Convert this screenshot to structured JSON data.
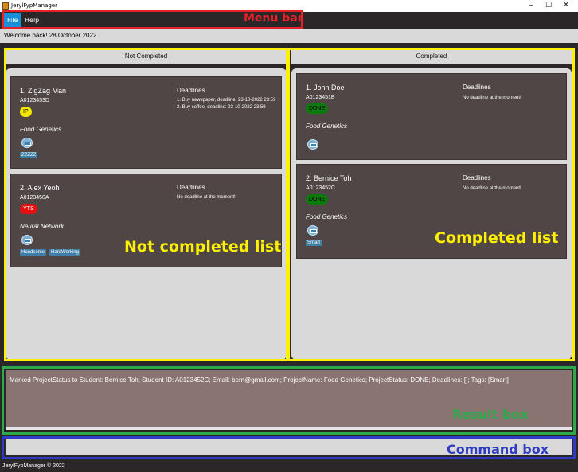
{
  "window": {
    "title": "JerylFypManager"
  },
  "menu": {
    "items": [
      "File",
      "Help"
    ]
  },
  "welcome": "Welcome back! 28 October 2022",
  "panels": {
    "not_completed": {
      "header": "Not Completed",
      "cards": [
        {
          "name": "1.  ZigZag Man",
          "id": "A0123453D",
          "status": "IP",
          "status_color": "#f2e600",
          "status_text_color": "#000000",
          "project": "Food Genetics",
          "tags": [
            "ZZZZZ"
          ],
          "deadlines_title": "Deadlines",
          "deadlines": [
            "1. Buy newspaper, deadline: 23-10-2022 23:59",
            "2. Buy coffee, deadline: 23-10-2022 23:59"
          ]
        },
        {
          "name": "2.  Alex Yeoh",
          "id": "A0123450A",
          "status": "YTS",
          "status_color": "#e61010",
          "status_text_color": "#ffffff",
          "project": "Neural Network",
          "tags": [
            "Handsome",
            "HardWorking"
          ],
          "deadlines_title": "Deadlines",
          "deadlines": [
            "No deadline at the moment!"
          ]
        }
      ]
    },
    "completed": {
      "header": "Completed",
      "cards": [
        {
          "name": "1.  John Doe",
          "id": "A0123451B",
          "status": "DONE",
          "status_color": "#0a7a0a",
          "status_text_color": "#000000",
          "project": "Food Genetics",
          "tags": [],
          "deadlines_title": "Deadlines",
          "deadlines": [
            "No deadline at the moment!"
          ]
        },
        {
          "name": "2.  Bernice Toh",
          "id": "A0123452C",
          "status": "DONE",
          "status_color": "#0a7a0a",
          "status_text_color": "#000000",
          "project": "Food Genetics",
          "tags": [
            "Smart"
          ],
          "deadlines_title": "Deadlines",
          "deadlines": [
            "No deadline at the moment!"
          ]
        }
      ]
    }
  },
  "annotations": {
    "menu_bar": "Menu bar",
    "not_completed_list": "Not completed list",
    "completed_list": "Completed list",
    "result_box": "Result box",
    "command_box": "Command box"
  },
  "result_text": "Marked ProjectStatus to Student: Bernice Toh; Student ID: A0123452C; Email: bern@gmail.com; ProjectName: Food Genetics; ProjectStatus: DONE; Deadlines: []; Tags: [Smart]",
  "command": {
    "value": "",
    "placeholder": ""
  },
  "footer": "JerylFypManager © 2022",
  "colors": {
    "menu_frame": "#e8202a",
    "list_frame": "#ffef00",
    "result_frame": "#2da84a",
    "command_frame": "#2e3cc4",
    "menu_label": "#e8202a",
    "list_label": "#ffef00",
    "result_label": "#2da84a",
    "command_label": "#2e3cc4"
  }
}
